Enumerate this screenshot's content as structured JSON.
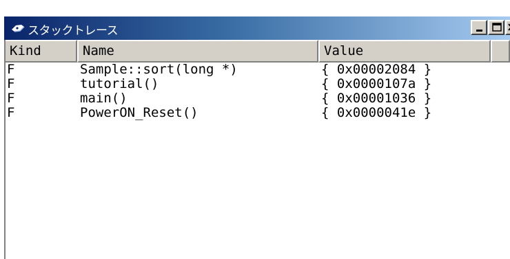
{
  "window": {
    "title": "スタックトレース",
    "icon": "stack-trace-icon",
    "controls": {
      "minimize_icon": "minimize-icon",
      "maximize_icon": "maximize-icon",
      "close_icon": "close-icon"
    }
  },
  "table": {
    "columns": [
      "Kind",
      "Name",
      "Value"
    ],
    "rows": [
      {
        "kind": "F",
        "name": "Sample::sort(long *)",
        "value": "{ 0x00002084 }"
      },
      {
        "kind": "F",
        "name": "tutorial()",
        "value": "{ 0x0000107a }"
      },
      {
        "kind": "F",
        "name": "main()",
        "value": "{ 0x00001036 }"
      },
      {
        "kind": "F",
        "name": "PowerON_Reset()",
        "value": "{ 0x0000041e }"
      }
    ]
  },
  "colors": {
    "titlebar_start": "#0a246a",
    "titlebar_end": "#a6caf0",
    "face": "#d4d0c8"
  }
}
